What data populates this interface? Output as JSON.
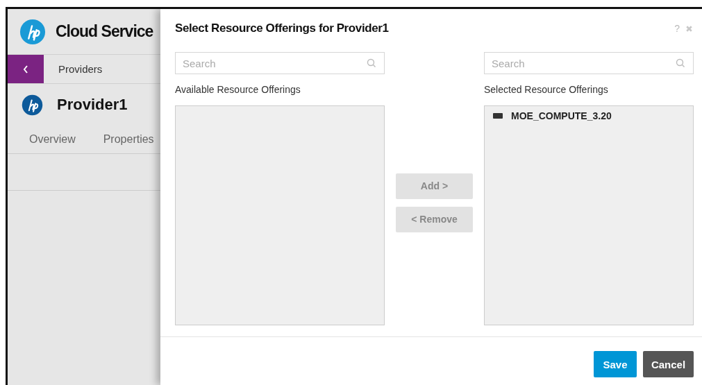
{
  "app": {
    "title": "Cloud Service",
    "nav": {
      "label": "Providers"
    },
    "provider": {
      "name": "Provider1"
    },
    "tabs": [
      {
        "label": "Overview",
        "selected": false
      },
      {
        "label": "Properties",
        "selected": false
      }
    ]
  },
  "dialog": {
    "title": "Select Resource Offerings for Provider1",
    "help": "?",
    "available": {
      "search": {
        "placeholder": "Search"
      },
      "label": "Available Resource Offerings"
    },
    "actions": [
      {
        "label": "Add >",
        "disabled": true
      },
      {
        "label": "< Remove",
        "disabled": true
      }
    ],
    "selected": {
      "search": {
        "placeholder": "Search"
      },
      "label": "Selected Resource Offerings",
      "items": [
        {
          "name": "MOE_COMPUTE_3.20"
        }
      ]
    },
    "buttons": [
      {
        "label": "Save",
        "kind": "primary"
      },
      {
        "label": "Cancel",
        "kind": "secondary"
      }
    ]
  }
}
